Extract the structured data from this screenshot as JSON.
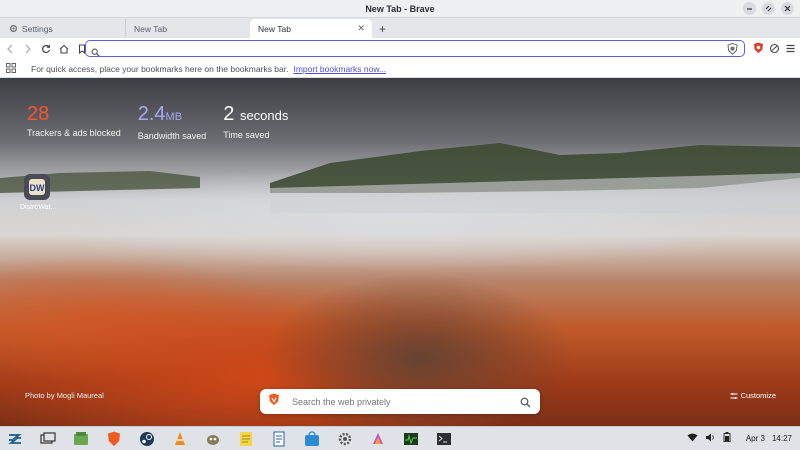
{
  "window": {
    "title": "New Tab - Brave"
  },
  "tabs": [
    {
      "label": "Settings"
    },
    {
      "label": "New Tab"
    },
    {
      "label": "New Tab"
    }
  ],
  "toolbar": {
    "url_value": ""
  },
  "bookmarks_bar": {
    "message": "For quick access, place your bookmarks here on the bookmarks bar.",
    "import_link": "Import bookmarks now..."
  },
  "stats": {
    "trackers": {
      "value": "28",
      "label": "Trackers & ads blocked"
    },
    "bandwidth": {
      "value": "2.4",
      "unit": "MB",
      "label": "Bandwidth saved"
    },
    "time": {
      "value": "2",
      "unit": "seconds",
      "label": "Time saved"
    }
  },
  "top_site": {
    "label": "DistroWat..."
  },
  "photo_credit": "Photo by Mogli Maureal",
  "customize_label": "Customize",
  "search": {
    "placeholder": "Search the web privately"
  },
  "taskbar": {
    "apps": [
      "zorin-menu",
      "show-desktop",
      "files",
      "brave",
      "steam",
      "vlc",
      "gimp",
      "notes",
      "writer",
      "software",
      "settings",
      "color-picker",
      "system-monitor",
      "terminal"
    ],
    "date": "Apr 3",
    "time": "14:27"
  },
  "colors": {
    "accent": "#5b5ce2",
    "trackers": "#fb542b",
    "bandwidth": "#a7a7f5"
  }
}
